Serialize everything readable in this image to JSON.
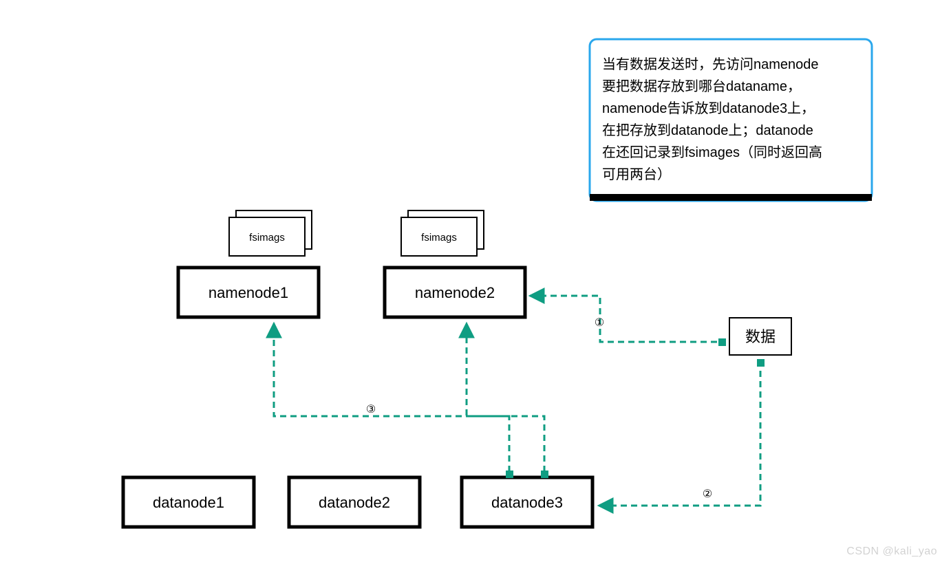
{
  "colors": {
    "stroke": "#0f9d82",
    "black": "#000000",
    "blue": "#2aa7ec"
  },
  "nodes": {
    "namenode1": "namenode1",
    "namenode2": "namenode2",
    "datanode1": "datanode1",
    "datanode2": "datanode2",
    "datanode3": "datanode3",
    "data": "数据",
    "fsimags1": "fsimags",
    "fsimags2": "fsimags"
  },
  "steps": {
    "s1": "①",
    "s2": "②",
    "s3": "③"
  },
  "description": {
    "line1": "当有数据发送时，先访问namenode",
    "line2": "要把数据存放到哪台dataname，",
    "line3": "namenode告诉放到datanode3上，",
    "line4": "在把存放到datanode上；datanode",
    "line5": "在还回记录到fsimages（同时返回高",
    "line6": "可用两台）"
  },
  "watermark": "CSDN @kali_yao"
}
